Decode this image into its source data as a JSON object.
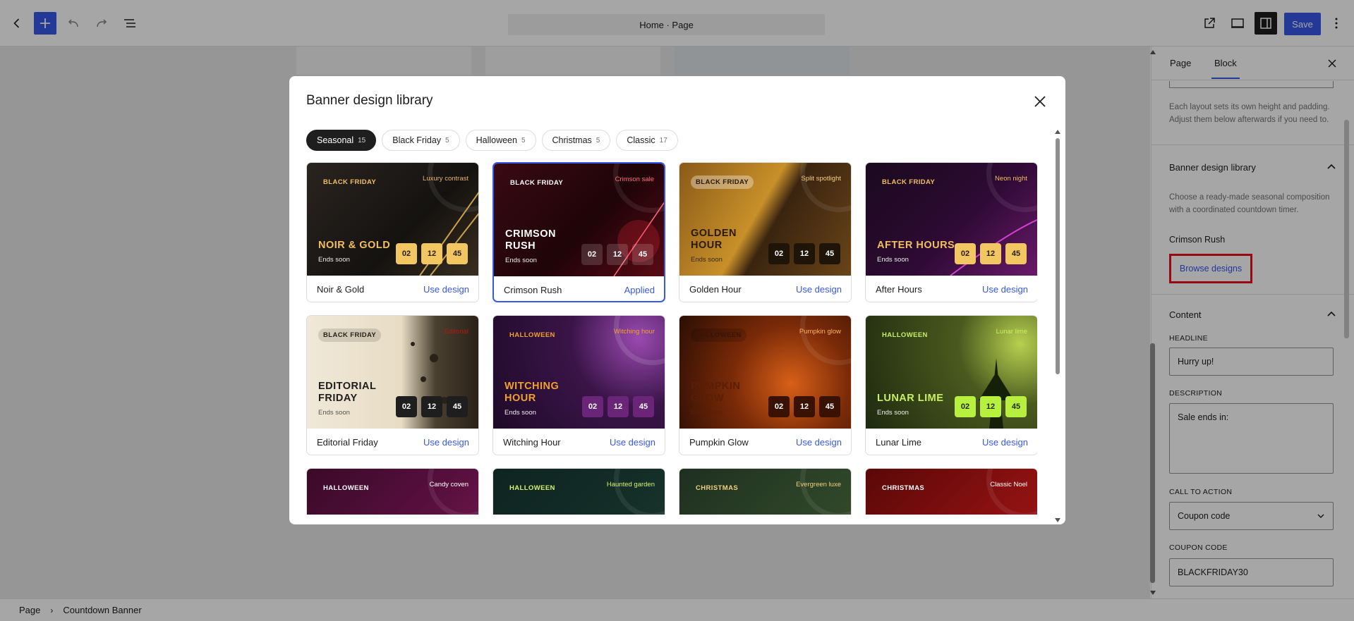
{
  "topbar": {
    "document_title": "Home · Page",
    "save_label": "Save"
  },
  "sidebar": {
    "tabs": [
      "Page",
      "Block"
    ],
    "layout_help": "Each layout sets its own height and padding. Adjust them below afterwards if you need to.",
    "library_panel": {
      "title": "Banner design library",
      "description": "Choose a ready-made seasonal composition with a coordinated countdown timer.",
      "current_design": "Crimson Rush",
      "browse_label": "Browse designs"
    },
    "content_panel": {
      "title": "Content",
      "headline_label": "HEADLINE",
      "headline_value": "Hurry up!",
      "description_label": "DESCRIPTION",
      "description_value": "Sale ends in:",
      "cta_label": "CALL TO ACTION",
      "cta_value": "Coupon code",
      "coupon_label": "COUPON CODE",
      "coupon_value": "BLACKFRIDAY30"
    }
  },
  "footer": {
    "breadcrumb": [
      "Page",
      "Countdown Banner"
    ]
  },
  "modal": {
    "title": "Banner design library",
    "filters": [
      {
        "label": "Seasonal",
        "count": "15"
      },
      {
        "label": "Black Friday",
        "count": "5"
      },
      {
        "label": "Halloween",
        "count": "5"
      },
      {
        "label": "Christmas",
        "count": "5"
      },
      {
        "label": "Classic",
        "count": "17"
      }
    ],
    "cards": [
      {
        "name": "Noir & Gold",
        "badge": "BLACK FRIDAY",
        "tag": "Luxury contrast",
        "headline": "NOIR & GOLD",
        "sub": "Ends soon",
        "timer": [
          "02",
          "12",
          "45"
        ],
        "action": "Use design"
      },
      {
        "name": "Crimson Rush",
        "badge": "BLACK FRIDAY",
        "tag": "Crimson sale",
        "headline": "CRIMSON RUSH",
        "sub": "Ends soon",
        "timer": [
          "02",
          "12",
          "45"
        ],
        "action": "Applied"
      },
      {
        "name": "Golden Hour",
        "badge": "BLACK FRIDAY",
        "tag": "Split spotlight",
        "headline": "GOLDEN HOUR",
        "sub": "Ends soon",
        "timer": [
          "02",
          "12",
          "45"
        ],
        "action": "Use design"
      },
      {
        "name": "After Hours",
        "badge": "BLACK FRIDAY",
        "tag": "Neon night",
        "headline": "AFTER HOURS",
        "sub": "Ends soon",
        "timer": [
          "02",
          "12",
          "45"
        ],
        "action": "Use design"
      },
      {
        "name": "Editorial Friday",
        "badge": "BLACK FRIDAY",
        "tag": "Editorial",
        "headline": "EDITORIAL FRIDAY",
        "sub": "Ends soon",
        "timer": [
          "02",
          "12",
          "45"
        ],
        "action": "Use design"
      },
      {
        "name": "Witching Hour",
        "badge": "HALLOWEEN",
        "tag": "Witching hour",
        "headline": "WITCHING HOUR",
        "sub": "Ends soon",
        "timer": [
          "02",
          "12",
          "45"
        ],
        "action": "Use design"
      },
      {
        "name": "Pumpkin Glow",
        "badge": "HALLOWEEN",
        "tag": "Pumpkin glow",
        "headline": "PUMPKIN GLOW",
        "sub": "Ends soon",
        "timer": [
          "02",
          "12",
          "45"
        ],
        "action": "Use design"
      },
      {
        "name": "Lunar Lime",
        "badge": "HALLOWEEN",
        "tag": "Lunar lime",
        "headline": "LUNAR LIME",
        "sub": "Ends soon",
        "timer": [
          "02",
          "12",
          "45"
        ],
        "action": "Use design"
      },
      {
        "badge": "HALLOWEEN",
        "tag": "Candy coven"
      },
      {
        "badge": "HALLOWEEN",
        "tag": "Haunted garden"
      },
      {
        "badge": "CHRISTMAS",
        "tag": "Evergreen luxe"
      },
      {
        "badge": "CHRISTMAS",
        "tag": "Classic Noel"
      }
    ]
  },
  "colors": {
    "accent": "#3858e9",
    "highlight_box": "#e8101b"
  }
}
